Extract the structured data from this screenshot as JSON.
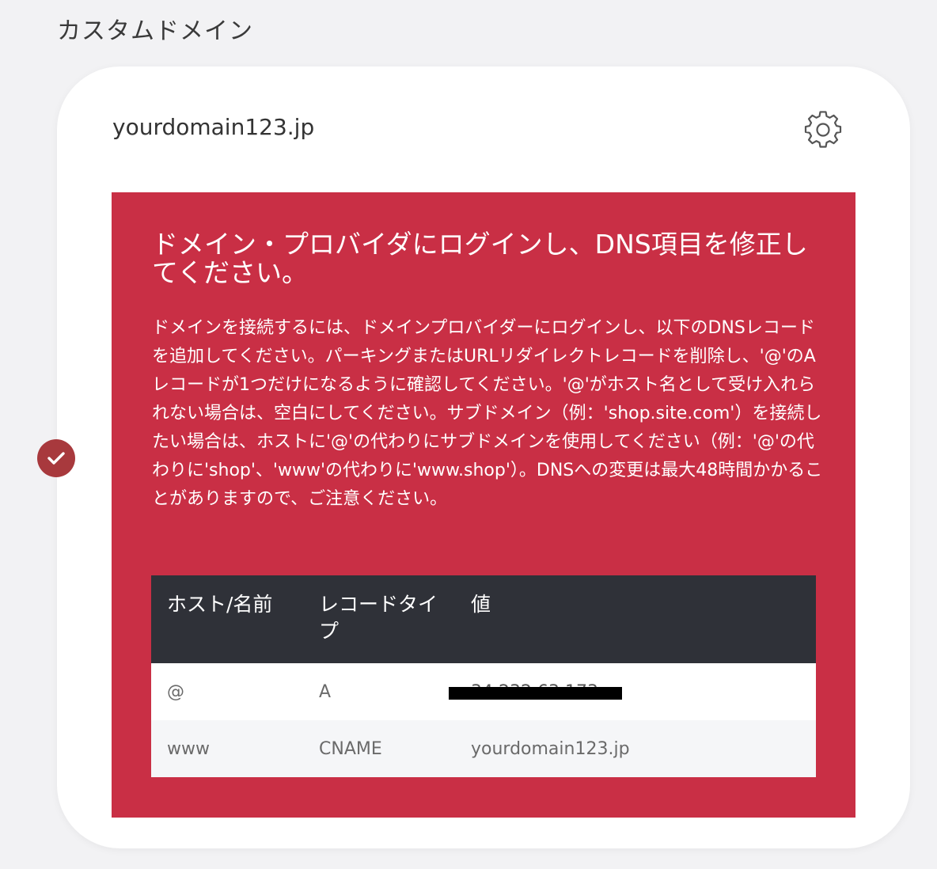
{
  "section": {
    "title": "カスタムドメイン"
  },
  "card": {
    "domain": "yourdomain123.jp",
    "settings_icon": "gear-icon",
    "status_icon": "check-circle-icon"
  },
  "alert": {
    "title": "ドメイン・プロバイダにログインし、DNS項目を修正してください。",
    "body": "ドメインを接続するには、ドメインプロバイダーにログインし、以下のDNSレコードを追加してください。パーキングまたはURLリダイレクトレコードを削除し、'@'のAレコードが1つだけになるように確認してください。'@'がホスト名として受け入れられない場合は、空白にしてください。サブドメイン（例：'shop.site.com'）を接続したい場合は、ホストに'@'の代わりにサブドメインを使用してください（例：'@'の代わりに'shop'、'www'の代わりに'www.shop'）。DNSへの変更は最大48時間かかることがありますので、ご注意ください。"
  },
  "table": {
    "headers": [
      "ホスト/名前",
      "レコードタイプ",
      "値"
    ],
    "rows": [
      {
        "host": "@",
        "type": "A",
        "value": "34.232.63.173"
      },
      {
        "host": "www",
        "type": "CNAME",
        "value": "yourdomain123.jp"
      }
    ]
  },
  "colors": {
    "alert_bg": "#c92f45",
    "header_bg": "#2f3138",
    "badge_bg": "#a8393d"
  }
}
